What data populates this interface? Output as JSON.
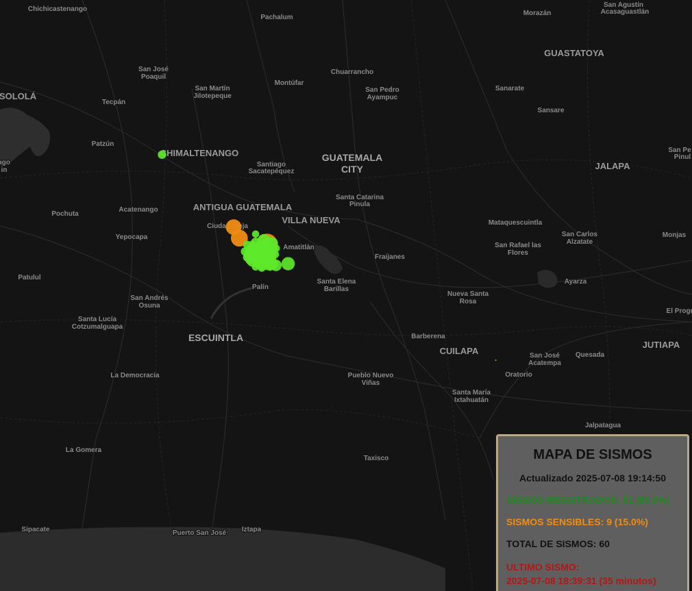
{
  "legend": {
    "title": "MAPA DE SISMOS",
    "updated": "Actualizado 2025-07-08 19:14:50",
    "registered": "SISMOS REGISTRADOS: 51 (85.0%)",
    "sensible": "SISMOS SENSIBLES: 9 (15.0%)",
    "total": "TOTAL DE SISMOS: 60",
    "last_label": "ULTIMO SISMO:",
    "last_value": "2025-07-08 18:39:31 (35 minutos)",
    "colors": {
      "registered": "#5ee82a",
      "sensible": "#f08c12",
      "last": "#b01818"
    }
  },
  "places": [
    "Chichicastenango",
    "Pachalum",
    "Morazán",
    "San Agustín",
    "Acasaguastlán",
    "GUASTATOYA",
    "San José",
    "Poaquil",
    "Chuarrancho",
    "SOLOLÁ",
    "San Martín",
    "Jilotepeque",
    "Montúfar",
    "San Pedro",
    "Ayampuc",
    "Sanarate",
    "Tecpán",
    "Sansare",
    "Patzún",
    "CHIMALTENANGO",
    "Santiago",
    "Sacatepéquez",
    "GUATEMALA",
    "CITY",
    "JALAPA",
    "San Pe",
    "Pinul",
    "Acatenango",
    "ANTIGUA GUATEMALA",
    "Santa Catarina",
    "Pinula",
    "Pochuta",
    "Ciudad Vieja",
    "VILLA NUEVA",
    "Mataquescuintla",
    "Yepocapa",
    "Amatitlán",
    "San Carlos",
    "Alzatate",
    "Monjas",
    "San Rafael las",
    "Flores",
    "Fraijanes",
    "Patulul",
    "Santa Elena",
    "Barillas",
    "Ayarza",
    "Palín",
    "San Andrés",
    "Osuna",
    "Nueva Santa",
    "Rosa",
    "El Progr",
    "Santa Lucía",
    "Cotzumalguapa",
    "ESCUINTLA",
    "Barberena",
    "CUILAPA",
    "San José",
    "Acatempa",
    "Quesada",
    "JUTIAPA",
    "La Democracia",
    "Oratorio",
    "Pueblo Nuevo",
    "Viñas",
    "Santa María",
    "Ixtahuatán",
    "Jalpatagua",
    "La Gomera",
    "Taxisco",
    "Sipacate",
    "Puerto San José",
    "Iztapa",
    "ago",
    "in"
  ],
  "earthquakes": [
    {
      "lat": 14.59,
      "lon": -90.87,
      "mag": 2.4,
      "type": "registered"
    },
    {
      "lat": 14.395,
      "lon": -90.64,
      "mag": 2.2,
      "type": "registered"
    },
    {
      "lat": 14.412,
      "lon": -90.694,
      "mag": 3.6,
      "type": "sensible"
    },
    {
      "lat": 14.385,
      "lon": -90.68,
      "mag": 3.8,
      "type": "sensible"
    },
    {
      "lat": 14.37,
      "lon": -90.612,
      "mag": 4.5,
      "type": "sensible"
    },
    {
      "lat": 14.352,
      "lon": -90.62,
      "mag": 4.1,
      "type": "sensible"
    },
    {
      "lat": 14.34,
      "lon": -90.615,
      "mag": 3.9,
      "type": "sensible"
    },
    {
      "lat": 14.342,
      "lon": -90.64,
      "mag": 3.4,
      "type": "sensible"
    },
    {
      "lat": 14.33,
      "lon": -90.63,
      "mag": 3.3,
      "type": "sensible"
    },
    {
      "lat": 14.322,
      "lon": -90.602,
      "mag": 3.2,
      "type": "sensible"
    },
    {
      "lat": 14.35,
      "lon": -90.604,
      "mag": 3.2,
      "type": "sensible"
    },
    {
      "lat": 14.38,
      "lon": -90.62,
      "mag": 3.0,
      "type": "registered"
    },
    {
      "lat": 14.372,
      "lon": -90.6,
      "mag": 3.0,
      "type": "registered"
    },
    {
      "lat": 14.365,
      "lon": -90.63,
      "mag": 2.8,
      "type": "registered"
    },
    {
      "lat": 14.36,
      "lon": -90.645,
      "mag": 2.9,
      "type": "registered"
    },
    {
      "lat": 14.35,
      "lon": -90.655,
      "mag": 2.7,
      "type": "registered"
    },
    {
      "lat": 14.342,
      "lon": -90.652,
      "mag": 3.0,
      "type": "registered"
    },
    {
      "lat": 14.335,
      "lon": -90.64,
      "mag": 2.9,
      "type": "registered"
    },
    {
      "lat": 14.328,
      "lon": -90.648,
      "mag": 2.8,
      "type": "registered"
    },
    {
      "lat": 14.325,
      "lon": -90.635,
      "mag": 2.7,
      "type": "registered"
    },
    {
      "lat": 14.32,
      "lon": -90.625,
      "mag": 2.8,
      "type": "registered"
    },
    {
      "lat": 14.345,
      "lon": -90.61,
      "mag": 2.8,
      "type": "registered"
    },
    {
      "lat": 14.358,
      "lon": -90.598,
      "mag": 2.6,
      "type": "registered"
    },
    {
      "lat": 14.362,
      "lon": -90.61,
      "mag": 3.1,
      "type": "registered"
    },
    {
      "lat": 14.368,
      "lon": -90.62,
      "mag": 2.6,
      "type": "registered"
    },
    {
      "lat": 14.355,
      "lon": -90.64,
      "mag": 2.5,
      "type": "registered"
    },
    {
      "lat": 14.347,
      "lon": -90.628,
      "mag": 2.6,
      "type": "registered"
    },
    {
      "lat": 14.338,
      "lon": -90.622,
      "mag": 2.5,
      "type": "registered"
    },
    {
      "lat": 14.332,
      "lon": -90.612,
      "mag": 2.5,
      "type": "registered"
    },
    {
      "lat": 14.318,
      "lon": -90.612,
      "mag": 2.6,
      "type": "registered"
    },
    {
      "lat": 14.338,
      "lon": -90.66,
      "mag": 2.5,
      "type": "registered"
    },
    {
      "lat": 14.352,
      "lon": -90.666,
      "mag": 2.4,
      "type": "registered"
    },
    {
      "lat": 14.368,
      "lon": -90.66,
      "mag": 2.4,
      "type": "registered"
    },
    {
      "lat": 14.375,
      "lon": -90.64,
      "mag": 2.5,
      "type": "registered"
    },
    {
      "lat": 14.378,
      "lon": -90.607,
      "mag": 2.4,
      "type": "registered"
    },
    {
      "lat": 14.355,
      "lon": -90.618,
      "mag": 2.3,
      "type": "registered"
    },
    {
      "lat": 14.322,
      "lon": -90.596,
      "mag": 2.5,
      "type": "registered"
    },
    {
      "lat": 14.318,
      "lon": -90.59,
      "mag": 2.9,
      "type": "registered"
    },
    {
      "lat": 14.322,
      "lon": -90.56,
      "mag": 3.2,
      "type": "registered"
    },
    {
      "lat": 14.335,
      "lon": -90.6,
      "mag": 2.4,
      "type": "registered"
    },
    {
      "lat": 14.345,
      "lon": -90.592,
      "mag": 2.3,
      "type": "registered"
    },
    {
      "lat": 14.36,
      "lon": -90.59,
      "mag": 2.3,
      "type": "registered"
    },
    {
      "lat": 14.362,
      "lon": -90.652,
      "mag": 2.3,
      "type": "registered"
    },
    {
      "lat": 14.33,
      "lon": -90.655,
      "mag": 2.3,
      "type": "registered"
    },
    {
      "lat": 14.315,
      "lon": -90.64,
      "mag": 2.3,
      "type": "registered"
    },
    {
      "lat": 14.312,
      "lon": -90.625,
      "mag": 2.3,
      "type": "registered"
    },
    {
      "lat": 14.37,
      "lon": -90.63,
      "mag": 2.2,
      "type": "registered"
    },
    {
      "lat": 14.352,
      "lon": -90.632,
      "mag": 2.2,
      "type": "registered"
    },
    {
      "lat": 14.34,
      "lon": -90.606,
      "mag": 2.2,
      "type": "registered"
    },
    {
      "lat": 14.327,
      "lon": -90.62,
      "mag": 2.2,
      "type": "registered"
    },
    {
      "lat": 14.365,
      "lon": -90.612,
      "mag": 2.1,
      "type": "registered"
    },
    {
      "lat": 14.348,
      "lon": -90.645,
      "mag": 2.1,
      "type": "registered"
    },
    {
      "lat": 14.336,
      "lon": -90.632,
      "mag": 2.1,
      "type": "registered"
    },
    {
      "lat": 14.358,
      "lon": -90.625,
      "mag": 2.0,
      "type": "registered"
    },
    {
      "lat": 14.344,
      "lon": -90.62,
      "mag": 2.0,
      "type": "registered"
    },
    {
      "lat": 14.33,
      "lon": -90.64,
      "mag": 2.0,
      "type": "registered"
    },
    {
      "lat": 14.326,
      "lon": -90.605,
      "mag": 2.0,
      "type": "registered"
    },
    {
      "lat": 14.372,
      "lon": -90.648,
      "mag": 2.0,
      "type": "registered"
    },
    {
      "lat": 14.312,
      "lon": -90.605,
      "mag": 2.0,
      "type": "registered"
    },
    {
      "lat": 14.085,
      "lon": -90.05,
      "mag": 1.2,
      "type": "registered"
    }
  ]
}
